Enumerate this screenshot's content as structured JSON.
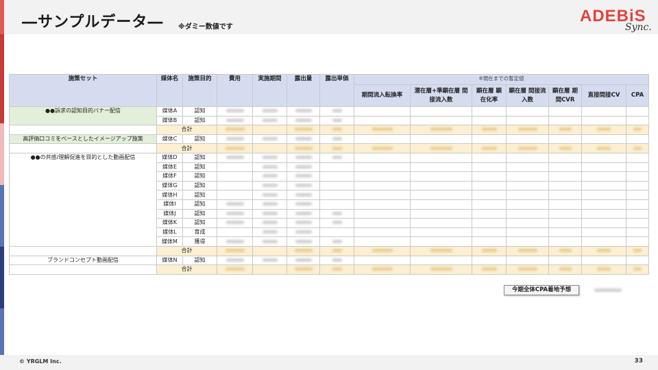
{
  "header": {
    "title": "―サンプルデータ―",
    "note": "※ダミー数値です"
  },
  "logo": {
    "main": "ADEBiS",
    "sub": "Sync."
  },
  "colors": {
    "sidebar": [
      "#e05a5a",
      "#c73a3a",
      "#f1b9b9",
      "#5a72b8",
      "#2f3c7c",
      "#5a72b8"
    ],
    "header_bg": "#d6dcf0",
    "group_bg": "#e2efd9",
    "subtotal_bg": "#fcefd2",
    "logo": "#e0433d"
  },
  "table": {
    "headers": {
      "campaign": "施策セット",
      "media": "媒体名",
      "purpose": "施策目的",
      "cost": "費用",
      "period": "実施期間",
      "impressions": "露出量",
      "unit_price": "露出単価",
      "estimate_note": "※現在までの暫定値",
      "period_conv": "期間流入転換率",
      "latent_indirect": "潜在層+準顕在層 間接流入数",
      "manifest_rate": "顕在層 顕在化率",
      "manifest_indirect": "顕在層 間接流入数",
      "manifest_cvr": "顕在層 期間CVR",
      "direct_indirect_cv": "直接間接CV",
      "cpa": "CPA"
    },
    "groups": [
      {
        "name": "●●訴求の認知目的バナー配信",
        "rows": [
          {
            "media": "媒体A",
            "purpose": "認知"
          },
          {
            "media": "媒体B",
            "purpose": "認知"
          }
        ],
        "subtotal": "合計"
      },
      {
        "name": "高評価口コミをベースとしたイメージアップ施策",
        "rows": [
          {
            "media": "媒体C",
            "purpose": "認知"
          }
        ],
        "subtotal": "合計"
      },
      {
        "name": "●●の共感/理解促進を目的とした動画配信",
        "rows": [
          {
            "media": "媒体D",
            "purpose": "認知"
          },
          {
            "media": "媒体E",
            "purpose": "認知"
          },
          {
            "media": "媒体F",
            "purpose": "認知"
          },
          {
            "media": "媒体G",
            "purpose": "認知"
          },
          {
            "media": "媒体H",
            "purpose": "認知"
          },
          {
            "media": "媒体I",
            "purpose": "認知"
          },
          {
            "media": "媒体J",
            "purpose": "認知"
          },
          {
            "media": "媒体K",
            "purpose": "認知"
          },
          {
            "media": "媒体L",
            "purpose": "育成"
          },
          {
            "media": "媒体M",
            "purpose": "獲得"
          }
        ],
        "subtotal": "合計"
      },
      {
        "name": "ブランドコンセプト動画配信",
        "rows": [
          {
            "media": "媒体N",
            "purpose": "認知"
          }
        ],
        "subtotal": "合計"
      }
    ]
  },
  "forecast": {
    "label": "今期全体CPA着地予想"
  },
  "footer": {
    "copyright": "© YRGLM Inc.",
    "page": "33"
  }
}
